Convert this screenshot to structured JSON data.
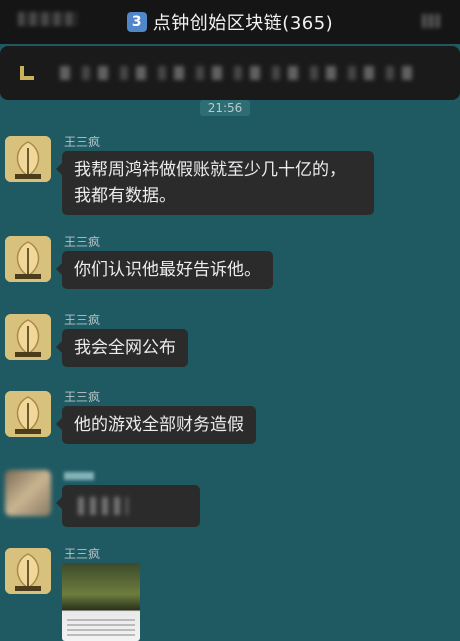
{
  "header": {
    "badge": "3",
    "title": "点钟创始区块链(365)"
  },
  "chat": {
    "timestamp": "21:56",
    "messages": [
      {
        "sender": "王三疯",
        "text_line1": "我帮周鸿祎做假账就至少几十亿的，",
        "text_line2": "我都有数据。"
      },
      {
        "sender": "王三疯",
        "text": "你们认识他最好告诉他。"
      },
      {
        "sender": "王三疯",
        "text": "我会全网公布"
      },
      {
        "sender": "王三疯",
        "text": "他的游戏全部财务造假"
      },
      {
        "sender": "王三疯"
      }
    ]
  },
  "colors": {
    "background": "#1f5a63",
    "bubble": "#2b2b2b",
    "header": "#151515"
  },
  "icons": {
    "avatar": "peach-avatar",
    "badge": "keycap-3"
  }
}
